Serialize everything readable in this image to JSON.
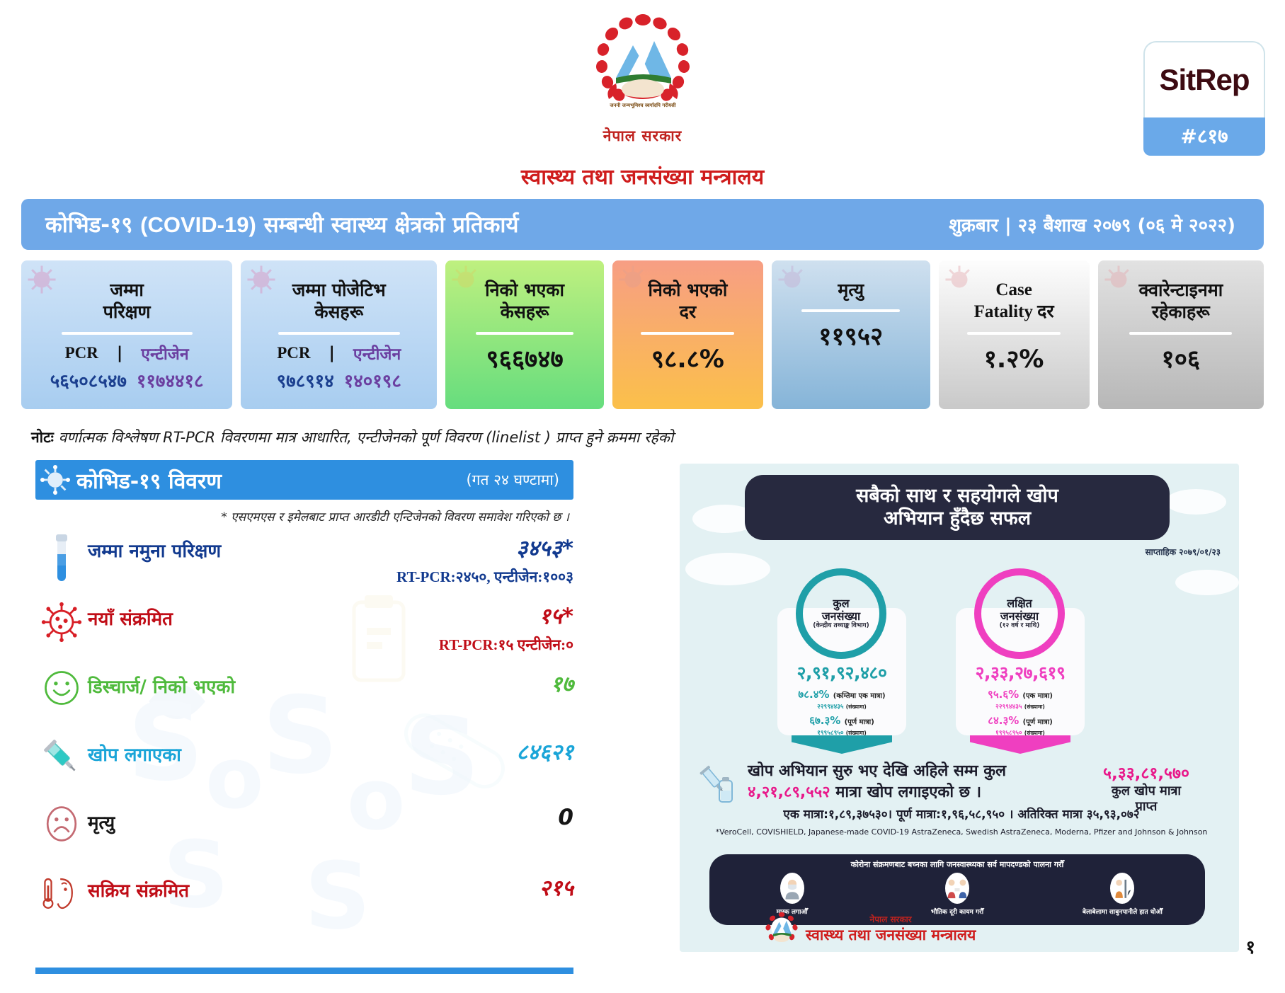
{
  "masthead": {
    "emblem_icon": "nepal-government-emblem",
    "gov_line": "नेपाल सरकार",
    "ministry_line": "स्वास्थ्य तथा जनसंख्या मन्त्रालय",
    "sitrep_label": "SitRep",
    "sitrep_number": "#८१७"
  },
  "titlebar": {
    "title_prefix": "कोभिड-१९ ",
    "title_en": "(COVID-19)",
    "title_suffix": " सम्बन्धी स्वास्थ्य क्षेत्रको प्रतिकार्य",
    "date": "शुक्रबार | २३ बैशाख २०७९ (०६ मे २०२२)"
  },
  "cards": [
    {
      "title_line1": "जम्मा",
      "title_line2": "परिक्षण",
      "label_pcr": "PCR",
      "separator": "|",
      "label_antigen": "एन्टीजेन",
      "value_pcr": "५६५०८५४७",
      "value_antigen": "११७४४१८",
      "icon": "virus-icon",
      "style": "card-blue"
    },
    {
      "title_line1": "जम्मा पोजेटिभ",
      "title_line2": "केसहरू",
      "label_pcr": "PCR",
      "separator": "|",
      "label_antigen": "एन्टीजेन",
      "value_pcr": "९७८९१४",
      "value_antigen": "१४०१९८",
      "icon": "virus-icon",
      "style": "card-blue2"
    },
    {
      "title_line1": "निको भएका",
      "title_line2": "केसहरू",
      "value": "९६६७४७",
      "icon": "virus-icon",
      "style": "card-green"
    },
    {
      "title_line1": "निको भएको",
      "title_line2": "दर",
      "value": "९८.८%",
      "icon": "virus-icon",
      "style": "card-orange"
    },
    {
      "title_line1": "मृत्यु",
      "title_line2": "",
      "value": "११९५२",
      "icon": "virus-icon",
      "style": "card-steel"
    },
    {
      "title_line1": "Case",
      "title_line2": "Fatality दर",
      "value": "१.२%",
      "icon": "virus-icon",
      "style": "card-grey"
    },
    {
      "title_line1": "क्वारेन्टाइनमा",
      "title_line2": "रहेकाहरू",
      "value": "१०६",
      "icon": "virus-icon",
      "style": "card-grey2"
    }
  ],
  "note": {
    "bold": "नोटः",
    "text": " वर्णात्मक विश्लेषण RT-PCR विवरणमा मात्र आधारित, एन्टीजेनको पूर्ण विवरण (linelist ) प्राप्त हुने क्रममा रहेको"
  },
  "panel": {
    "header_title": "कोभिड-१९ विवरण",
    "header_sub": "(गत २४ घण्टामा)",
    "header_icon": "virus-icon",
    "footnote": "* एसएमएस र इमेलबाट प्राप्त आरडीटी एन्टिजेनको विवरण समावेश गरिएको छ ।",
    "rows": [
      {
        "icon": "test-tube-icon",
        "label": "जम्मा नमुना परिक्षण",
        "value": "३४५३*",
        "sub": "RT-PCR:२४५०, एन्टीजेन:१००३",
        "color": "c-navy"
      },
      {
        "icon": "virus-red-icon",
        "label": "नयाँ संक्रमित",
        "value": "१५*",
        "sub": "RT-PCR:१५ एन्टीजेन:०",
        "color": "c-red"
      },
      {
        "icon": "smiley-icon",
        "label": "डिस्चार्ज/ निको भएको",
        "value": "१७",
        "sub": "",
        "color": "c-green"
      },
      {
        "icon": "syringe-icon",
        "label": "खोप लगाएका",
        "value": "८४६२१",
        "sub": "",
        "color": "c-cyan"
      },
      {
        "icon": "sad-face-icon",
        "label": "मृत्यु",
        "value": "0",
        "sub": "",
        "color": "c-dark"
      },
      {
        "icon": "fever-patient-icon",
        "label": "सक्रिय संक्रमित",
        "value": "२१५",
        "sub": "",
        "color": "c-red"
      }
    ]
  },
  "infographic": {
    "banner_line1": "सबैको साथ र सहयोगले खोप",
    "banner_line2": "अभियान हुँदैछ सफल",
    "date_stamp": "साप्ताहिक २०७९/०१/२३",
    "bubbles": [
      {
        "ring_line1": "कुल",
        "ring_line2": "जनसंख्या",
        "ring_line3": "(केन्द्रीय तथ्याङ्क विभाग)",
        "big_number": "२,९१,९२,४८०",
        "pct1": "७८.४%",
        "pct1_label": "(कम्तिमा एक मात्रा)",
        "count1": "२२९९४४३५",
        "count1_label": "(संख्यामा)",
        "pct2": "६७.३%",
        "pct2_label": "(पूर्ण मात्रा)",
        "count2": "१९९५८९५०",
        "count2_label": "(संख्यामा)",
        "color": "#1f9fa8"
      },
      {
        "ring_line1": "लक्षित",
        "ring_line2": "जनसंख्या",
        "ring_line3": "(१२ वर्ष र माथि)",
        "big_number": "२,३३,२७,६१९",
        "pct1": "९५.६%",
        "pct1_label": "(एक मात्रा)",
        "count1": "२२९९४४३५",
        "count1_label": "(संख्यामा)",
        "pct2": "८४.३%",
        "pct2_label": "(पूर्ण मात्रा)",
        "count2": "१९९५८९५०",
        "count2_label": "(संख्यामा)",
        "color": "#ef3fc0"
      }
    ],
    "vax": {
      "line1_a": "खोप अभियान सुरु भए देखि अहिले सम्म कुल",
      "line2_num": "४,२१,८९,५५२",
      "line2_b": " मात्रा खोप लगाइएको छ ।",
      "line3": "एक मात्रा:१,८९,३७५३०। पूर्ण मात्रा:१,९६,५८,९५० । अतिरिक्त मात्रा ३५,९३,०७२",
      "star_note": "*VeroCell, COVISHIELD, Japanese-made COVID-19 AstraZeneca, Swedish AstraZeneca, Moderna, Pfizer and Johnson & Johnson",
      "right_num": "५,३३,८१,५७०",
      "right_label_1": "कुल खोप मात्रा",
      "right_label_2": "प्राप्त",
      "icon": "syringe-vial-icon"
    },
    "dark_bar": {
      "title": "कोरोना संक्रमणबाट बच्नका लागि जनस्वास्थ्यका सर्व मापदण्डको पालना गरौँ",
      "items": [
        {
          "icon": "mask-person-icon",
          "caption": "मास्क लगाऔँ"
        },
        {
          "icon": "distance-icon",
          "caption": "भौतिक दूरी कायम गरौँ"
        },
        {
          "icon": "handwash-icon",
          "caption": "बेलाबेलामा साबुनपानीले हात धोऔँ"
        }
      ]
    },
    "footer": {
      "emblem_icon": "nepal-government-emblem",
      "gov": "नेपाल सरकार",
      "ministry": "स्वास्थ्य तथा जनसंख्या मन्त्रालय"
    }
  },
  "page_number": "१"
}
